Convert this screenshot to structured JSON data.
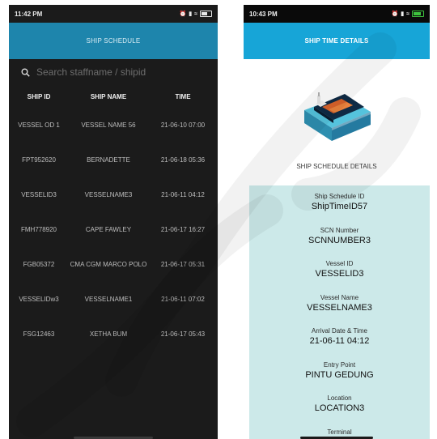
{
  "left_screen": {
    "status_time": "11:42 PM",
    "status_icons": "✱ .ıl ≡",
    "title": "SHIP SCHEDULE",
    "search_placeholder": "Search staffname / shipid",
    "columns": [
      "SHIP ID",
      "SHIP NAME",
      "TIME"
    ],
    "rows": [
      {
        "id": "VESSEL OD 1",
        "name": "VESSEL NAME 56",
        "time": "21-06-10 07:00"
      },
      {
        "id": "FPT952620",
        "name": "BERNADETTE",
        "time": "21-06-18 05:36"
      },
      {
        "id": "VESSELID3",
        "name": "VESSELNAME3",
        "time": "21-06-11 04:12"
      },
      {
        "id": "FMH778920",
        "name": "CAPE FAWLEY",
        "time": "21-06-17 16:27"
      },
      {
        "id": "FGB05372",
        "name": "CMA CGM MARCO POLO",
        "time": "21-06-17 05:31"
      },
      {
        "id": "VESSELIDw3",
        "name": "VESSELNAME1",
        "time": "21-06-11 07:02"
      },
      {
        "id": "FSG12463",
        "name": "XETHA BUM",
        "time": "21-06-17 05:43"
      }
    ]
  },
  "right_screen": {
    "status_time": "10:43 PM",
    "status_icons": "✱ .ıl ≡",
    "title": "SHIP TIME DETAILS",
    "section_label": "SHIP SCHEDULE DETAILS",
    "fields": [
      {
        "label": "Ship Schedule ID",
        "value": "ShipTimeID57"
      },
      {
        "label": "SCN Number",
        "value": "SCNNUMBER3"
      },
      {
        "label": "Vessel ID",
        "value": "VESSELID3"
      },
      {
        "label": "Vessel Name",
        "value": "VESSELNAME3"
      },
      {
        "label": "Arrival Date & Time",
        "value": "21-06-11 04:12"
      },
      {
        "label": "Entry Point",
        "value": "PINTU GEDUNG"
      },
      {
        "label": "Location",
        "value": "LOCATION3"
      },
      {
        "label": "Terminal",
        "value": ""
      }
    ]
  },
  "colors": {
    "left_appbar": "#1e85ac",
    "right_appbar": "#17a5d7",
    "details_bg": "#cce9e9",
    "left_bg": "#1b1b1b"
  }
}
